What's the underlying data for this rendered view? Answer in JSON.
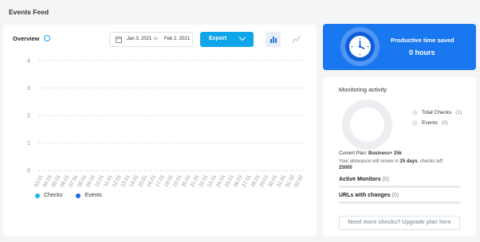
{
  "page": {
    "title": "Events Feed"
  },
  "overview": {
    "title": "Overview",
    "date_from": "Jan 3, 2021",
    "date_to_label": "to",
    "date_end": "Feb 2, 2021",
    "export_label": "Export"
  },
  "chart_data": {
    "type": "line",
    "x": [
      "03.01",
      "04.01",
      "05.01",
      "06.01",
      "07.01",
      "08.01",
      "09.01",
      "10.01",
      "11.01",
      "12.01",
      "13.01",
      "14.01",
      "15.01",
      "16.01",
      "17.01",
      "18.01",
      "19.01",
      "20.01",
      "21.01",
      "22.01",
      "23.01",
      "24.01",
      "25.01",
      "26.01",
      "27.01",
      "28.01",
      "29.01",
      "30.01",
      "31.01",
      "01.02",
      "02.02"
    ],
    "yticks": [
      "0",
      "1",
      "2",
      "3",
      "4"
    ],
    "ylim": [
      0,
      4
    ],
    "grid": true,
    "series": [
      {
        "name": "Checks",
        "values": [
          0,
          0,
          0,
          0,
          0,
          0,
          0,
          0,
          0,
          0,
          0,
          0,
          0,
          0,
          0,
          0,
          0,
          0,
          0,
          0,
          0,
          0,
          0,
          0,
          0,
          0,
          0,
          0,
          0,
          0,
          0
        ],
        "color": "#19b8f0"
      },
      {
        "name": "Events",
        "values": [
          0,
          0,
          0,
          0,
          0,
          0,
          0,
          0,
          0,
          0,
          0,
          0,
          0,
          0,
          0,
          0,
          0,
          0,
          0,
          0,
          0,
          0,
          0,
          0,
          0,
          0,
          0,
          0,
          0,
          0,
          0
        ],
        "color": "#1c6fe0"
      }
    ],
    "legend_position": "bottom-left"
  },
  "productive": {
    "title": "Productive time saved",
    "value": "0 hours",
    "icon": "clock-icon"
  },
  "monitoring": {
    "title": "Monitoring activity",
    "legend": [
      {
        "label": "Total Checks",
        "count": "(1)"
      },
      {
        "label": "Events",
        "count": "(0)"
      }
    ],
    "plan_prefix": "Current Plan:",
    "plan_name": "Business+ 25k",
    "renew_text": "Your allowance will renew in",
    "renew_days": "25 days",
    "checks_left_text": ", checks left",
    "checks_left": "25000",
    "active_monitors_label": "Active Monitors",
    "active_monitors_count": "(0)",
    "urls_changes_label": "URLs with changes",
    "urls_changes_count": "(0)",
    "upgrade_label": "Need more checks? Upgrade plan here"
  },
  "colors": {
    "accent": "#0ea5e9",
    "brand_blue": "#1978f0"
  }
}
